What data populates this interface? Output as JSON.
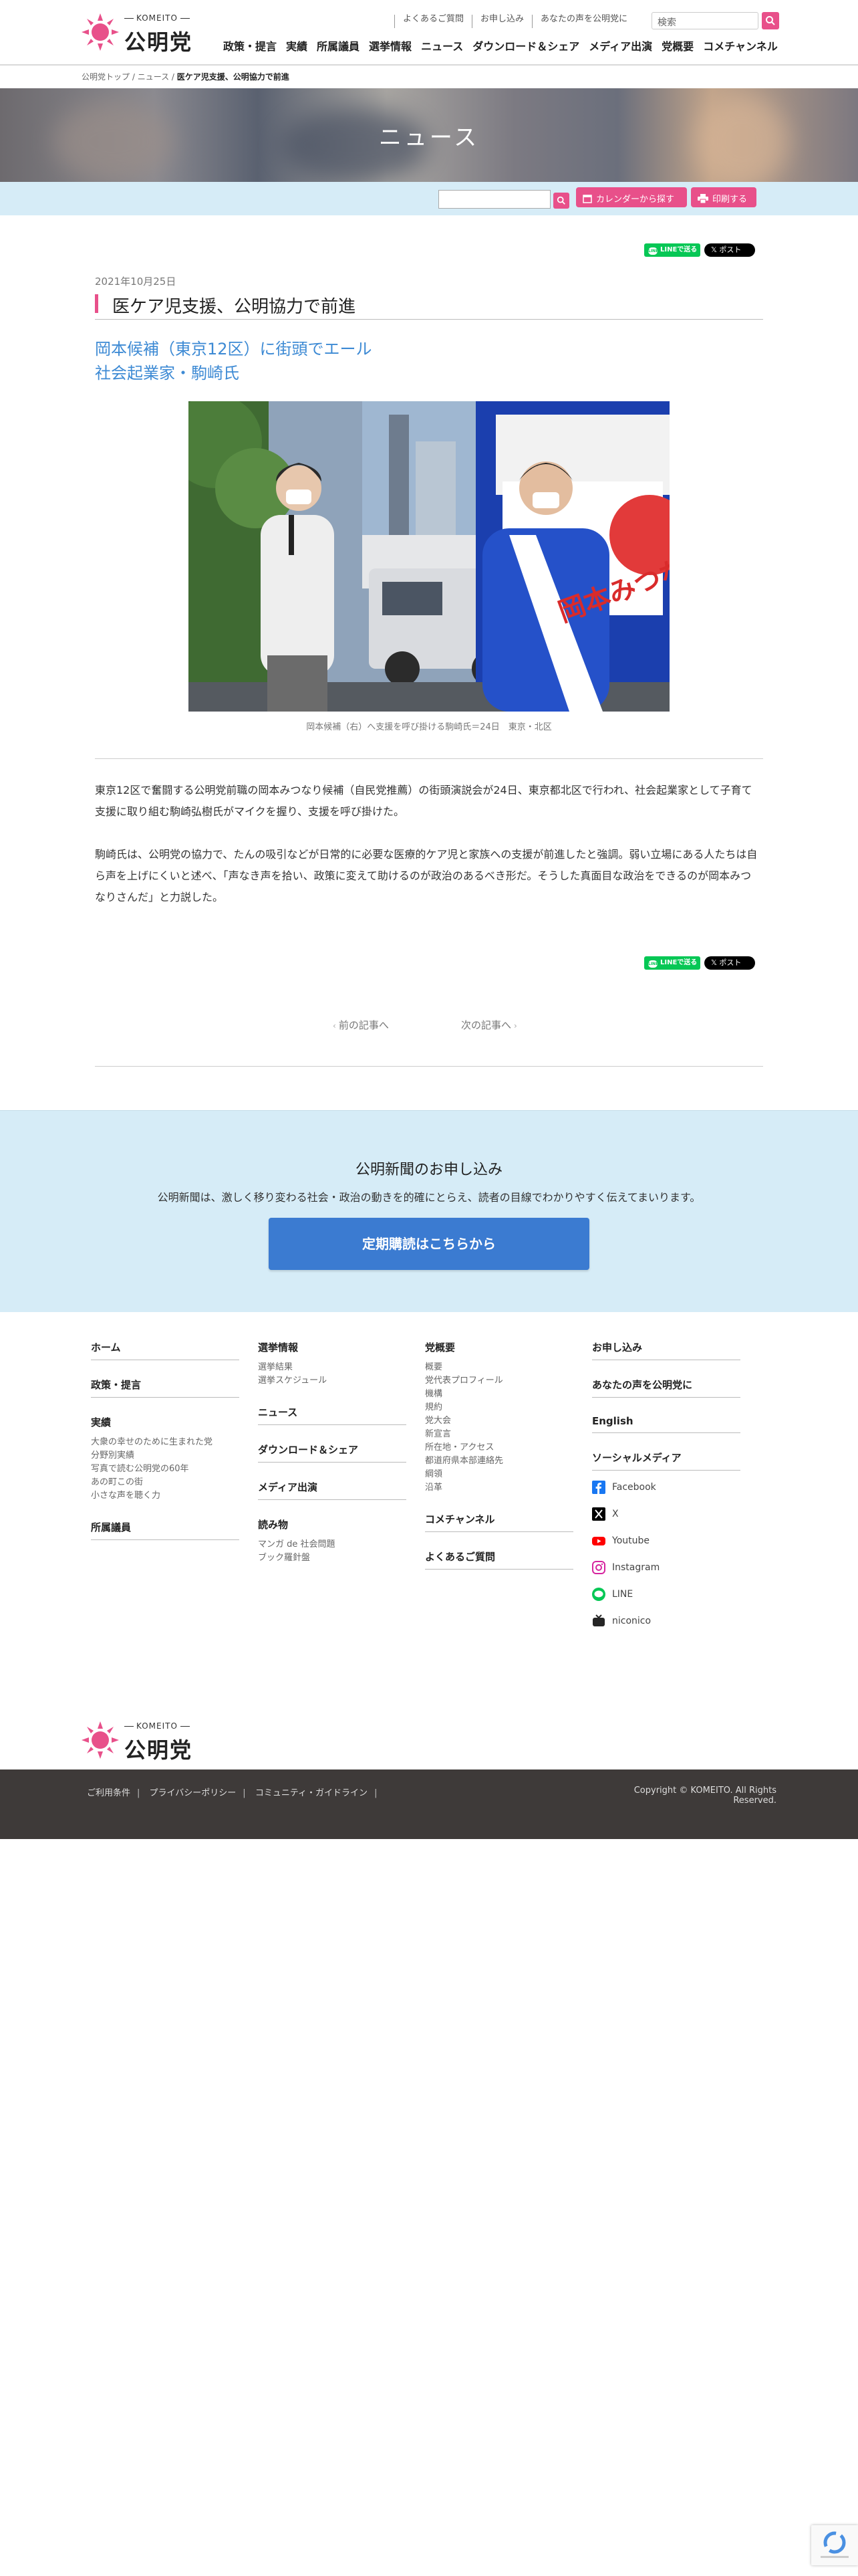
{
  "header": {
    "logo_sub": "KOMEITO",
    "logo_main": "公明党",
    "top_links": [
      "よくあるご質問",
      "お申し込み",
      "あなたの声を公明党に"
    ],
    "search_placeholder": "検索",
    "nav": [
      "政策・提言",
      "実績",
      "所属議員",
      "選挙情報",
      "ニュース",
      "ダウンロード＆シェア",
      "メディア出演",
      "党概要",
      "コメチャンネル"
    ],
    "accent_color": "#e8508a"
  },
  "breadcrumb": {
    "items": [
      "公明党トップ",
      "ニュース"
    ],
    "current": "医ケア児支援、公明協力で前進"
  },
  "hero": {
    "title": "ニュース"
  },
  "toolbar": {
    "calendar_label": "カレンダーから探す",
    "print_label": "印刷する"
  },
  "share": {
    "line_label": "LINEで送る",
    "x_label": "ポスト"
  },
  "article": {
    "date": "2021年10月25日",
    "title": "医ケア児支援、公明協力で前進",
    "subhead_1": "岡本候補（東京12区）に街頭でエール",
    "subhead_2": "社会起業家・駒崎氏",
    "photo_caption": "岡本候補（右）へ支援を呼び掛ける駒崎氏＝24日　東京・北区",
    "photo_sash_text": "岡本みつなり",
    "paragraph_1": "東京12区で奮闘する公明党前職の岡本みつなり候補（自民党推薦）の街頭演説会が24日、東京都北区で行われ、社会起業家として子育て支援に取り組む駒崎弘樹氏がマイクを握り、支援を呼び掛けた。",
    "paragraph_2": "駒崎氏は、公明党の協力で、たんの吸引などが日常的に必要な医療的ケア児と家族への支援が前進したと強調。弱い立場にある人たちは自ら声を上げにくいと述べ、「声なき声を拾い、政策に変えて助けるのが政治のあるべき形だ。そうした真面目な政治をできるのが岡本みつなりさんだ」と力説した。"
  },
  "pager": {
    "prev": "前の記事へ",
    "next": "次の記事へ"
  },
  "subscribe": {
    "title": "公明新聞のお申し込み",
    "description": "公明新聞は、激しく移り変わる社会・政治の動きを的確にとらえ、読者の目線でわかりやすく伝えてまいります。",
    "button": "定期購読はこちらから"
  },
  "footer": {
    "col1": {
      "home": "ホーム",
      "policy": "政策・提言",
      "achievements": "実績",
      "achievements_items": [
        "大衆の幸せのために生まれた党",
        "分野別実績",
        "写真で読む公明党の60年",
        "あの町この街",
        "小さな声を聴く力"
      ],
      "members": "所属議員"
    },
    "col2": {
      "election": "選挙情報",
      "election_items": [
        "選挙結果",
        "選挙スケジュール"
      ],
      "news": "ニュース",
      "download": "ダウンロード＆シェア",
      "media": "メディア出演",
      "reading": "読み物",
      "reading_items": [
        "マンガ de 社会問題",
        "ブック羅針盤"
      ]
    },
    "col3": {
      "about": "党概要",
      "about_items": [
        "概要",
        "党代表プロフィール",
        "機構",
        "規約",
        "党大会",
        "新宣言",
        "所在地・アクセス",
        "都道府県本部連絡先",
        "綱領",
        "沿革"
      ],
      "channel": "コメチャンネル",
      "faq": "よくあるご質問"
    },
    "col4": {
      "apply": "お申し込み",
      "voice": "あなたの声を公明党に",
      "english": "English",
      "social": "ソーシャルメディア",
      "social_items": [
        {
          "name": "Facebook",
          "icon": "facebook-icon",
          "color": "#1877f2"
        },
        {
          "name": "X",
          "icon": "x-icon",
          "color": "#000000"
        },
        {
          "name": "Youtube",
          "icon": "youtube-icon",
          "color": "#ff0000"
        },
        {
          "name": "Instagram",
          "icon": "instagram-icon",
          "color": "#d6249f"
        },
        {
          "name": "LINE",
          "icon": "line-icon",
          "color": "#06c755"
        },
        {
          "name": "niconico",
          "icon": "niconico-icon",
          "color": "#252525"
        }
      ]
    },
    "logo_sub": "KOMEITO",
    "logo_main": "公明党",
    "bottom_links": [
      "ご利用条件",
      "プライバシーポリシー",
      "コミュニティ・ガイドライン"
    ],
    "copyright": "Copyright © KOMEITO. All Rights Reserved."
  }
}
